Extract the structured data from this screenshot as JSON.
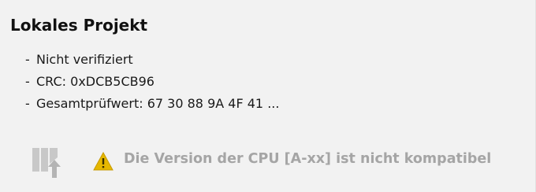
{
  "project": {
    "title": "Lokales Projekt",
    "details": [
      "Nicht verifiziert",
      "CRC: 0xDCB5CB96",
      "Gesamtprüfwert: 67 30 88 9A 4F 41 ..."
    ],
    "bullet": "-"
  },
  "status": {
    "device_icon": "device-download-icon",
    "warning_icon": "warning-triangle-icon",
    "warning_color": "#e6b800",
    "message": "Die Version der CPU [A-xx] ist nicht kompatibel"
  }
}
